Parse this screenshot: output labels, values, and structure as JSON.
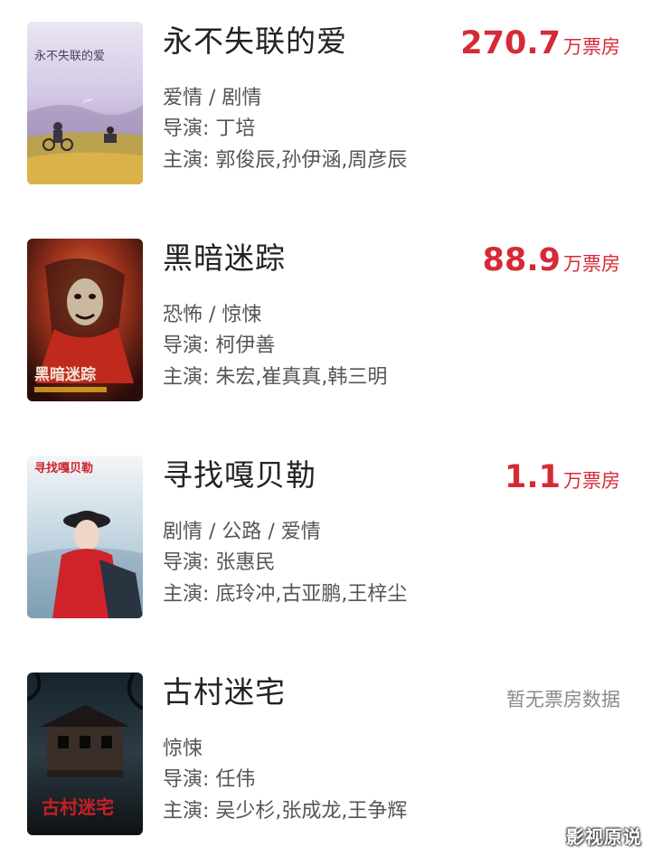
{
  "movies": [
    {
      "title": "永不失联的爱",
      "box_number": "270.7",
      "box_unit": "万票房",
      "genre": "爱情 / 剧情",
      "director": "导演: 丁培",
      "cast": "主演: 郭俊辰,孙伊涵,周彦辰",
      "poster_text": "永不失联的爱"
    },
    {
      "title": "黑暗迷踪",
      "box_number": "88.9",
      "box_unit": "万票房",
      "genre": "恐怖 / 惊悚",
      "director": "导演: 柯伊善",
      "cast": "主演: 朱宏,崔真真,韩三明",
      "poster_text": "黑暗迷踪"
    },
    {
      "title": "寻找嘎贝勒",
      "box_number": "1.1",
      "box_unit": "万票房",
      "genre": "剧情 / 公路 / 爱情",
      "director": "导演: 张惠民",
      "cast": "主演: 底玲冲,古亚鹏,王梓尘",
      "poster_text": "寻找嘎贝勒"
    },
    {
      "title": "古村迷宅",
      "box_none": "暂无票房数据",
      "genre": "惊悚",
      "director": "导演: 任伟",
      "cast": "主演: 吴少杉,张成龙,王争辉",
      "poster_text": "古村迷宅"
    }
  ],
  "watermark": "影视原说",
  "colors": {
    "box_office_red": "#d62a36",
    "muted_gray": "#8a8a8a"
  }
}
